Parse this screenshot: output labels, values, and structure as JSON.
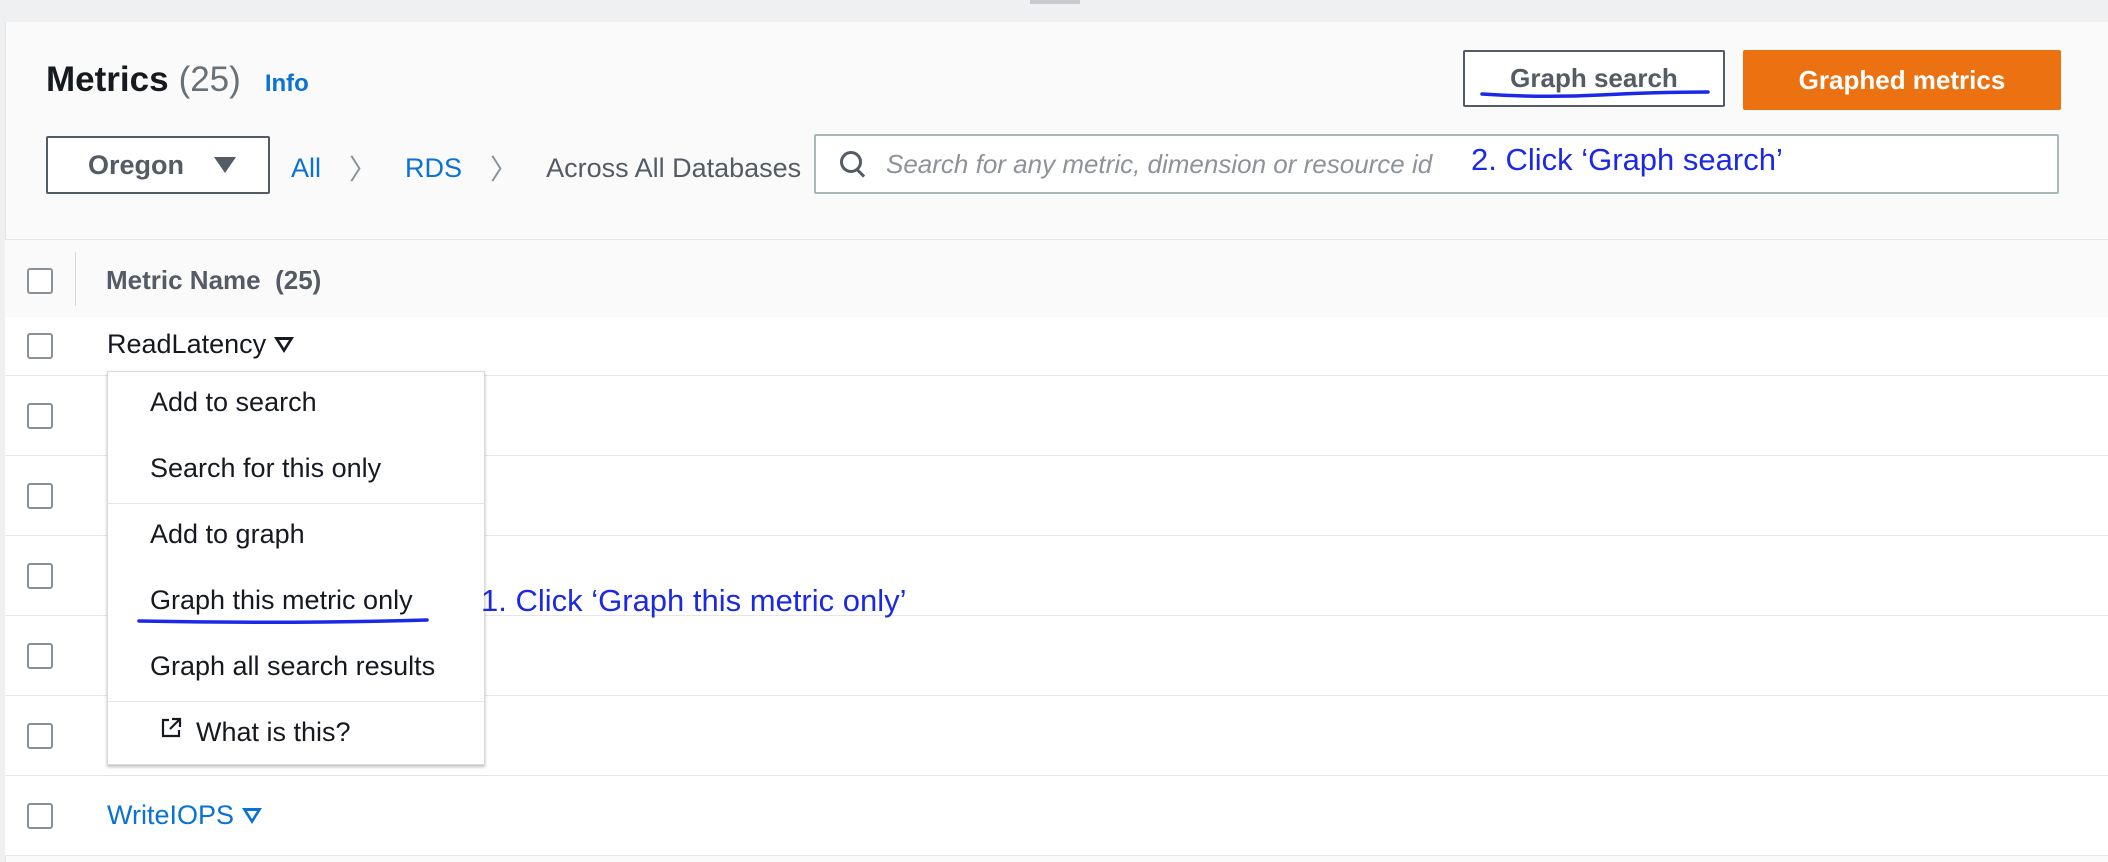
{
  "header": {
    "title": "Metrics",
    "count": "(25)",
    "info_link": "Info",
    "graph_search_button": "Graph search",
    "graphed_metrics_button": "Graphed metrics"
  },
  "filters": {
    "region": "Oregon",
    "breadcrumbs": [
      "All",
      "RDS",
      "Across All Databases"
    ]
  },
  "search": {
    "placeholder": "Search for any metric, dimension or resource id"
  },
  "table": {
    "column_header": "Metric Name",
    "column_count": "(25)",
    "rows": [
      {
        "label": "ReadLatency"
      },
      {
        "label": ""
      },
      {
        "label": ""
      },
      {
        "label": ""
      },
      {
        "label": ""
      },
      {
        "label": ""
      },
      {
        "label": "WriteIOPS"
      }
    ]
  },
  "context_menu": {
    "items": [
      "Add to search",
      "Search for this only",
      "Add to graph",
      "Graph this metric only",
      "Graph all search results",
      "What is this?"
    ]
  },
  "annotations": {
    "step1": "1. Click ‘Graph this metric only’",
    "step2": "2. Click ‘Graph search’"
  },
  "colors": {
    "accent_orange": "#ec7211",
    "link_blue": "#0972d3",
    "annotation_blue": "#1b29e6"
  }
}
